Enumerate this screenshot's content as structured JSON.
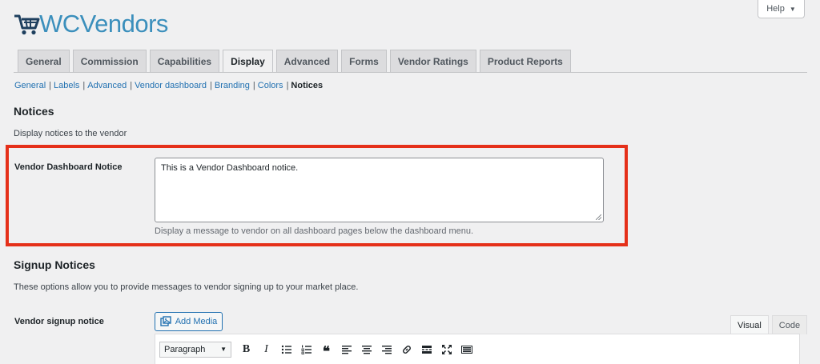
{
  "brand": {
    "name": "WCVendors",
    "color": "#3b8fbc"
  },
  "help": {
    "label": "Help",
    "caret": "▼"
  },
  "tabs": [
    {
      "label": "General"
    },
    {
      "label": "Commission"
    },
    {
      "label": "Capabilities"
    },
    {
      "label": "Display",
      "active": true
    },
    {
      "label": "Advanced"
    },
    {
      "label": "Forms"
    },
    {
      "label": "Vendor Ratings"
    },
    {
      "label": "Product Reports"
    }
  ],
  "subnav": {
    "items": [
      "General",
      "Labels",
      "Advanced",
      "Vendor dashboard",
      "Branding",
      "Colors"
    ],
    "current": "Notices",
    "separator": "|"
  },
  "notices": {
    "title": "Notices",
    "description": "Display notices to the vendor",
    "dashboard_notice": {
      "label": "Vendor Dashboard Notice",
      "value": "This is a Vendor Dashboard notice.",
      "help": "Display a message to vendor on all dashboard pages below the dashboard menu."
    }
  },
  "signup": {
    "title": "Signup Notices",
    "description": "These options allow you to provide messages to vendor signing up to your market place.",
    "signup_notice": {
      "label": "Vendor signup notice"
    },
    "add_media": "Add Media",
    "editor_tabs": [
      "Visual",
      "Code"
    ],
    "format_select": "Paragraph"
  },
  "colors": {
    "highlight": "#e5301a",
    "link": "#2271b1"
  }
}
